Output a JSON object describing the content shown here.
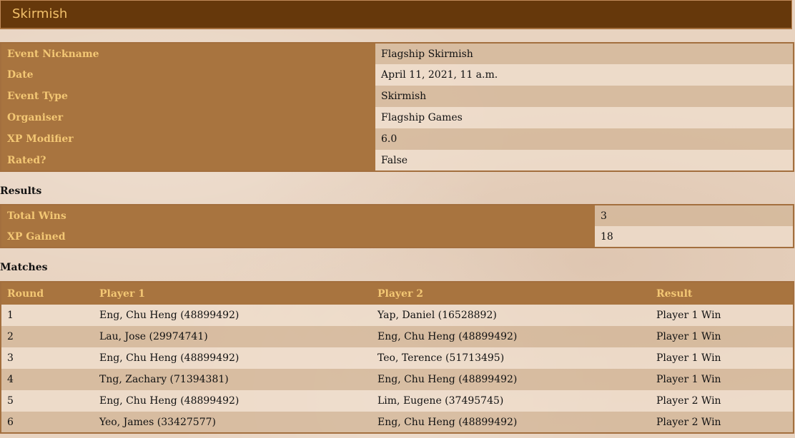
{
  "header": {
    "title": "Skirmish"
  },
  "details": [
    {
      "label": "Event Nickname",
      "value": "Flagship Skirmish"
    },
    {
      "label": "Date",
      "value": "April 11, 2021, 11 a.m."
    },
    {
      "label": "Event Type",
      "value": "Skirmish"
    },
    {
      "label": "Organiser",
      "value": "Flagship Games"
    },
    {
      "label": "XP Modifier",
      "value": "6.0"
    },
    {
      "label": "Rated?",
      "value": "False"
    }
  ],
  "results": {
    "heading": "Results",
    "rows": [
      {
        "label": "Total Wins",
        "value": "3"
      },
      {
        "label": "XP Gained",
        "value": "18"
      }
    ]
  },
  "matches": {
    "heading": "Matches",
    "columns": [
      "Round",
      "Player 1",
      "Player 2",
      "Result"
    ],
    "rows": [
      [
        "1",
        "Eng, Chu Heng (48899492)",
        "Yap, Daniel (16528892)",
        "Player 1 Win"
      ],
      [
        "2",
        "Lau, Jose (29974741)",
        "Eng, Chu Heng (48899492)",
        "Player 1 Win"
      ],
      [
        "3",
        "Eng, Chu Heng (48899492)",
        "Teo, Terence (51713495)",
        "Player 1 Win"
      ],
      [
        "4",
        "Tng, Zachary (71394381)",
        "Eng, Chu Heng (48899492)",
        "Player 1 Win"
      ],
      [
        "5",
        "Eng, Chu Heng (48899492)",
        "Lim, Eugene (37495745)",
        "Player 2 Win"
      ],
      [
        "6",
        "Yeo, James (33427577)",
        "Eng, Chu Heng (48899492)",
        "Player 2 Win"
      ]
    ]
  }
}
